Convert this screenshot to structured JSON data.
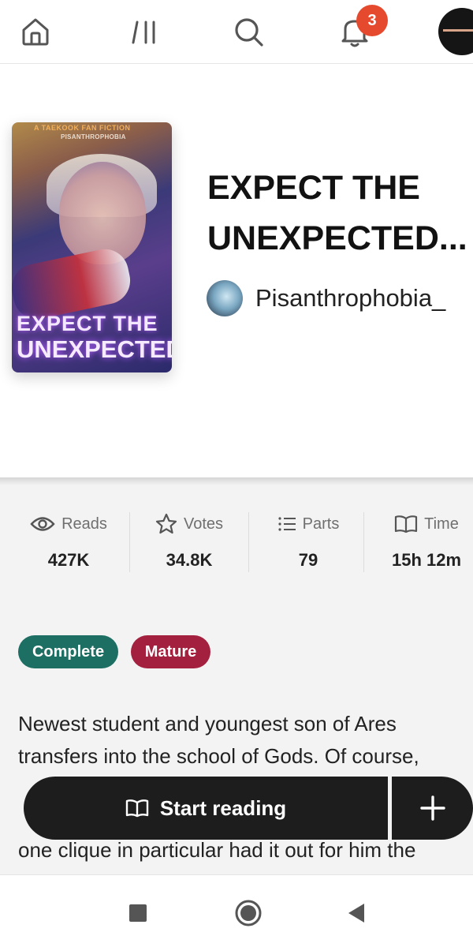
{
  "topnav": {
    "home_icon": "home-icon",
    "library_icon": "library-icon",
    "search_icon": "search-icon",
    "notifications_icon": "bell-icon",
    "notification_count": "3"
  },
  "story": {
    "cover": {
      "line1": "A TAEKOOK FAN FICTION",
      "line2": "PISANTHROPHOBIA",
      "title_line1": "EXPECT THE",
      "title_line2": "UNEXPECTED"
    },
    "title_line1": "EXPECT THE",
    "title_line2": "UNEXPECTED...",
    "author": "Pisanthrophobia_"
  },
  "stats": [
    {
      "icon": "eye-icon",
      "label": "Reads",
      "value": "427K"
    },
    {
      "icon": "star-icon",
      "label": "Votes",
      "value": "34.8K"
    },
    {
      "icon": "list-icon",
      "label": "Parts",
      "value": "79"
    },
    {
      "icon": "book-icon",
      "label": "Time",
      "value": "15h 12m"
    }
  ],
  "tags": [
    {
      "label": "Complete",
      "color": "#1d6f63"
    },
    {
      "label": "Mature",
      "color": "#a3213e"
    }
  ],
  "description": "Newest student and youngest son of Ares transfers into the school of Gods. Of course,",
  "description_last_line": "one clique in particular had it out for him the",
  "actions": {
    "start_reading_label": "Start reading",
    "add_label": "+"
  },
  "system_nav": {
    "recents_icon": "square-icon",
    "home_icon": "circle-icon",
    "back_icon": "back-triangle-icon"
  }
}
